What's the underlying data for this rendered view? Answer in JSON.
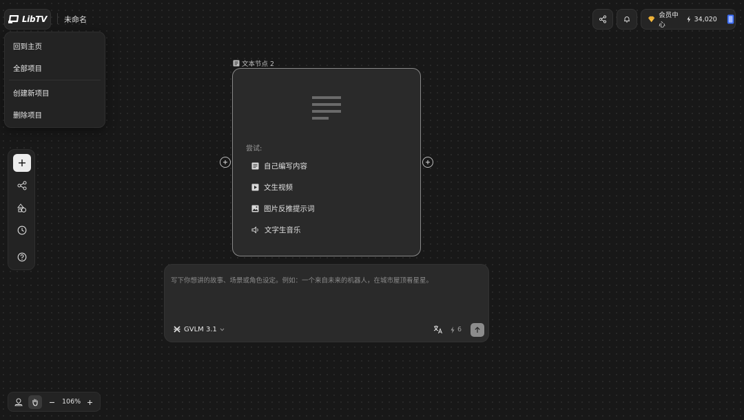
{
  "app": {
    "logo_text": "LibTV",
    "project_title": "未命名"
  },
  "menu": {
    "items": [
      {
        "label": "回到主页"
      },
      {
        "label": "全部项目"
      },
      {
        "label": "创建新项目"
      },
      {
        "label": "删除项目"
      }
    ]
  },
  "header": {
    "member_label": "会员中心",
    "credits": "34,020"
  },
  "node": {
    "title": "文本节点 2",
    "try_label": "尝试:",
    "options": [
      {
        "label": "自己编写内容",
        "icon": "document-icon"
      },
      {
        "label": "文生视频",
        "icon": "video-icon"
      },
      {
        "label": "图片反推提示词",
        "icon": "image-icon"
      },
      {
        "label": "文字生音乐",
        "icon": "speaker-icon"
      }
    ]
  },
  "prompt": {
    "placeholder": "写下你想讲的故事、场景或角色设定。例如：一个来自未来的机器人，在城市屋顶看星星。",
    "model": "GVLM 3.1",
    "cost": "6"
  },
  "canvas": {
    "zoom": "106%"
  },
  "colors": {
    "background": "#181818",
    "panel": "#2a2a2a",
    "accent_gem": "#f5b83d",
    "badge_blue": "#3b6cf6"
  }
}
